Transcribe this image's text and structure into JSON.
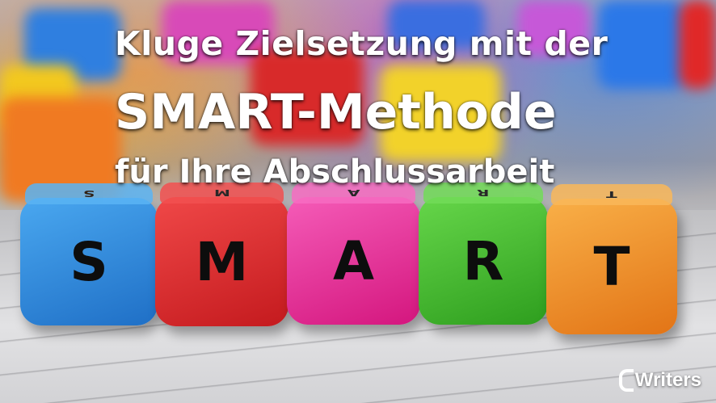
{
  "heading": {
    "line1": "Kluge Zielsetzung mit der",
    "line2": "SMART-Methode",
    "line3": "für Ihre Abschlussarbeit"
  },
  "cubes": [
    {
      "letter": "S",
      "top_letter": "S",
      "color": "#2a8fe0"
    },
    {
      "letter": "M",
      "top_letter": "M",
      "color": "#e8262a"
    },
    {
      "letter": "A",
      "top_letter": "A",
      "color": "#f0229a"
    },
    {
      "letter": "R",
      "top_letter": "R",
      "color": "#3fbf2a"
    },
    {
      "letter": "T",
      "top_letter": "T",
      "color": "#f5902a"
    }
  ],
  "logo": {
    "text": "Writers"
  }
}
